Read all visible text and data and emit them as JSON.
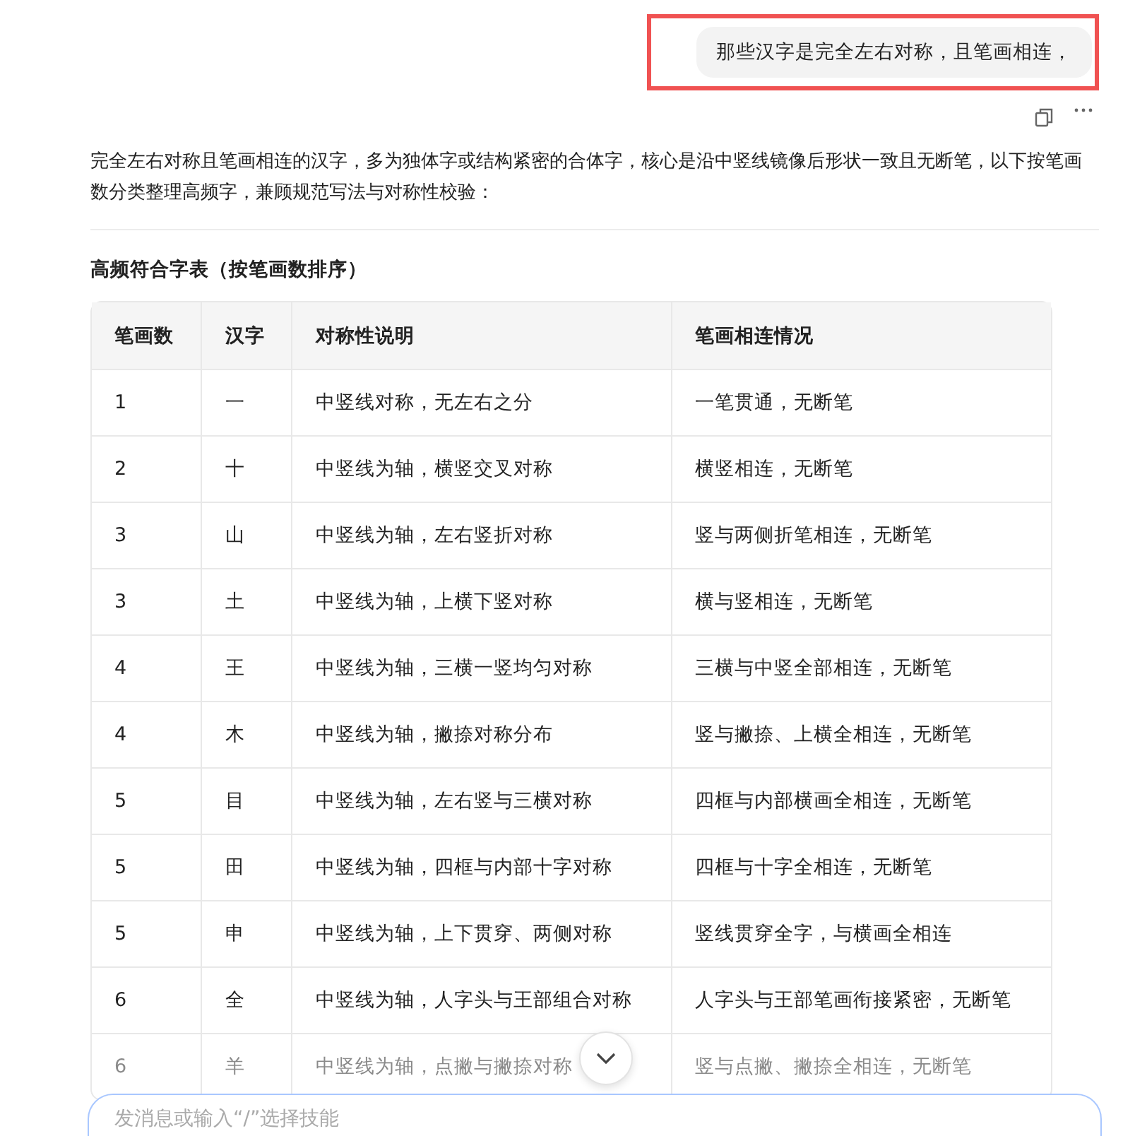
{
  "user_message": {
    "text": "那些汉字是完全左右对称，且笔画相连，",
    "highlighted": true
  },
  "answer": {
    "intro": "完全左右对称且笔画相连的汉字，多为独体字或结构紧密的合体字，核心是沿中竖线镜像后形状一致且无断笔，以下按笔画数分类整理高频字，兼顾规范写法与对称性校验：",
    "section_title": "高频符合字表（按笔画数排序）",
    "table": {
      "columns": [
        "笔画数",
        "汉字",
        "对称性说明",
        "笔画相连情况"
      ],
      "rows": [
        [
          "1",
          "一",
          "中竖线对称，无左右之分",
          "一笔贯通，无断笔"
        ],
        [
          "2",
          "十",
          "中竖线为轴，横竖交叉对称",
          "横竖相连，无断笔"
        ],
        [
          "3",
          "山",
          "中竖线为轴，左右竖折对称",
          "竖与两侧折笔相连，无断笔"
        ],
        [
          "3",
          "土",
          "中竖线为轴，上横下竖对称",
          "横与竖相连，无断笔"
        ],
        [
          "4",
          "王",
          "中竖线为轴，三横一竖均匀对称",
          "三横与中竖全部相连，无断笔"
        ],
        [
          "4",
          "木",
          "中竖线为轴，撇捺对称分布",
          "竖与撇捺、上横全相连，无断笔"
        ],
        [
          "5",
          "目",
          "中竖线为轴，左右竖与三横对称",
          "四框与内部横画全相连，无断笔"
        ],
        [
          "5",
          "田",
          "中竖线为轴，四框与内部十字对称",
          "四框与十字全相连，无断笔"
        ],
        [
          "5",
          "申",
          "中竖线为轴，上下贯穿、两侧对称",
          "竖线贯穿全字，与横画全相连"
        ],
        [
          "6",
          "全",
          "中竖线为轴，人字头与王部组合对称",
          "人字头与王部笔画衔接紧密，无断笔"
        ],
        [
          "6",
          "羊",
          "中竖线为轴，点撇与撇捺对称",
          "竖与点撇、撇捺全相连，无断笔"
        ]
      ]
    }
  },
  "input": {
    "placeholder": "发消息或输入“/”选择技能"
  }
}
